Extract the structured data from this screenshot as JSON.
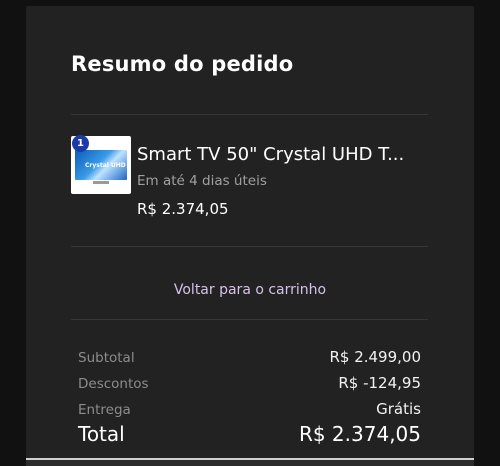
{
  "summary": {
    "title": "Resumo do pedido"
  },
  "item": {
    "quantity": "1",
    "name": "Smart TV 50\" Crystal UHD T...",
    "delivery": "Em até 4 dias úteis",
    "price": "R$ 2.374,05",
    "thumbnail_text": "Crystal UHD"
  },
  "actions": {
    "back_to_cart": "Voltar para o carrinho"
  },
  "totals": {
    "subtotal_label": "Subtotal",
    "subtotal_value": "R$ 2.499,00",
    "discount_label": "Descontos",
    "discount_value": "R$ -124,95",
    "shipping_label": "Entrega",
    "shipping_value": "Grátis",
    "total_label": "Total",
    "total_value": "R$ 2.374,05"
  },
  "colors": {
    "background": "#111111",
    "card": "#222222",
    "badge": "#1b3aa8",
    "link": "#d6c2e6"
  }
}
